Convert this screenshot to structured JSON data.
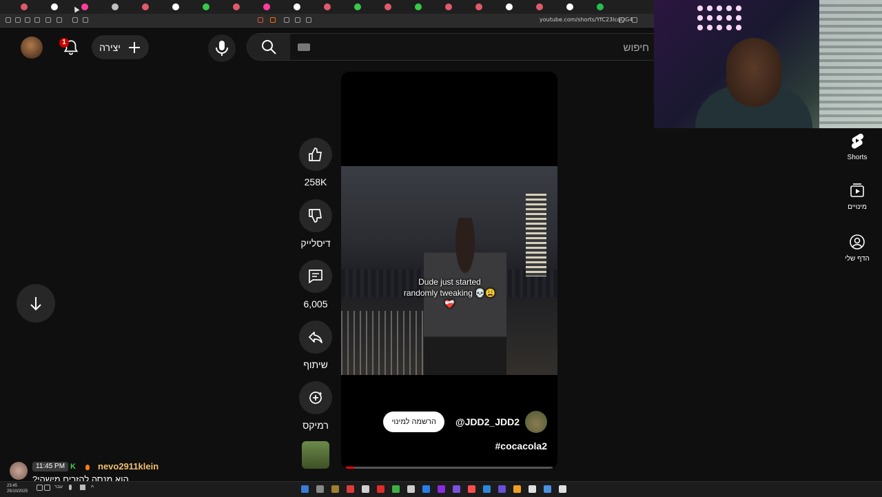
{
  "browser": {
    "url": "youtube.com/shorts/YfC23lcqQG4",
    "tab_icon_colors": [
      "#e05a6b",
      "#ffffff",
      "#ff3e9b",
      "#c0c0c0",
      "#e05a6b",
      "#ffffff",
      "#37c949",
      "#e05a6b",
      "#ff3e9b",
      "#ffffff",
      "#e05a6b",
      "#37c949",
      "#e05a6b",
      "#37c949",
      "#e05a6b",
      "#e05a6b",
      "#ffffff",
      "#e05a6b",
      "#ffffff",
      "#22c14b"
    ]
  },
  "masthead": {
    "notification_count": "1",
    "create_label": "יצירה",
    "search_placeholder": "חיפוש"
  },
  "short": {
    "caption": "Dude just started randomly tweaking 💀😩❤️‍🩹",
    "channel_handle": "@JDD2_JDD2",
    "subscribe_label": "הרשמה למינוי",
    "hashtag": "#cocacola2",
    "progress_fraction": 0.04
  },
  "actions": {
    "like_count": "258K",
    "dislike_label": "דיסלייק",
    "comment_count": "6,005",
    "share_label": "שיתוף",
    "remix_label": "רמיקס"
  },
  "right_nav": {
    "shorts_label": "Shorts",
    "subscriptions_label": "מינויים",
    "you_label": "הדף שלי"
  },
  "chat": {
    "time": "11:45 PM",
    "badge": "K",
    "username": "nevo2911klein",
    "message": "הוא מנסה להזרים מישהי?"
  },
  "taskbar": {
    "time": "23:45",
    "date": "25/10/2025",
    "lang": "עבר",
    "app_colors": [
      "#3a7bd5",
      "#888888",
      "#a08030",
      "#e03a3a",
      "#d0d0d0",
      "#e02a2a",
      "#3cb043",
      "#cccccc",
      "#2b7de9",
      "#8a2be2",
      "#7b4fe0",
      "#ff4d4d",
      "#2b88d8",
      "#6a4fd8",
      "#f0a020",
      "#e0e0e0",
      "#4a90e2",
      "#e0e0e0"
    ]
  }
}
